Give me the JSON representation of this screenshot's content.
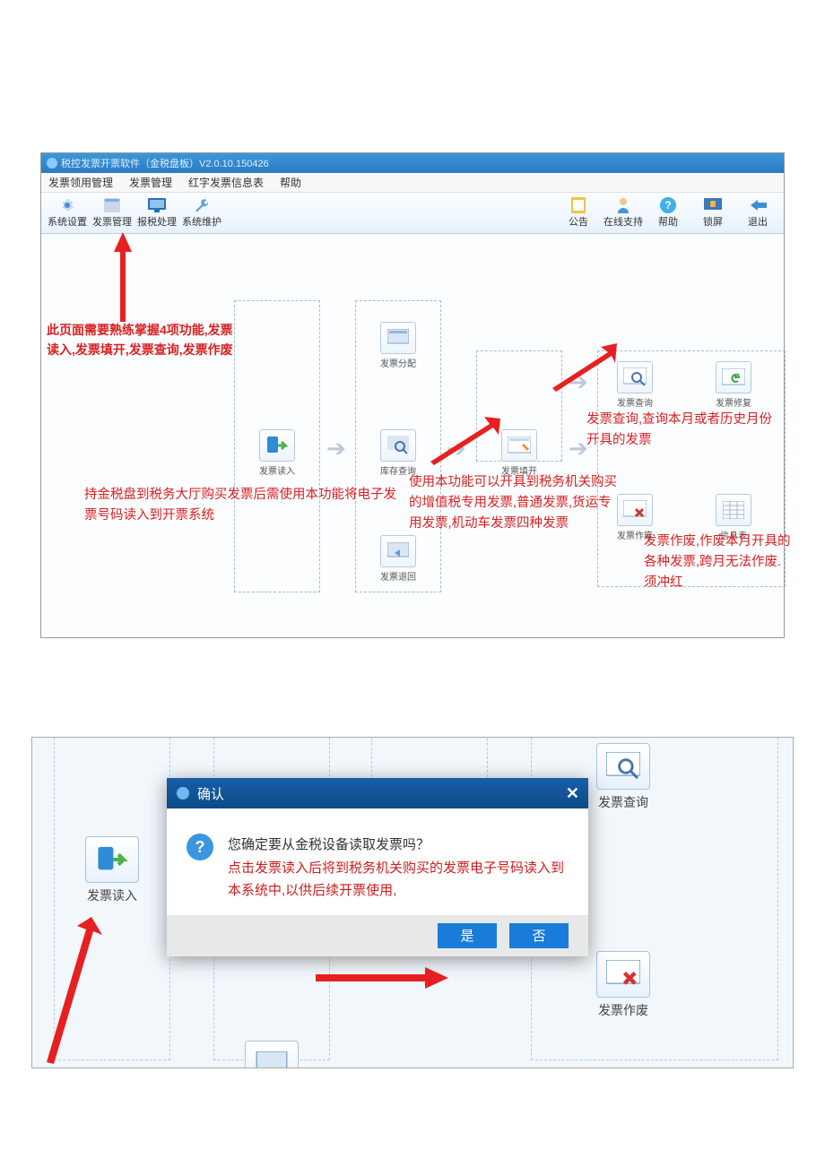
{
  "window_title": "税控发票开票软件（金税盘板）V2.0.10.150426",
  "menus": [
    "发票领用管理",
    "发票管理",
    "红字发票信息表",
    "帮助"
  ],
  "toolbar_left": [
    {
      "label": "系统设置",
      "icon": "gear-icon"
    },
    {
      "label": "发票管理",
      "icon": "grid-icon"
    },
    {
      "label": "报税处理",
      "icon": "monitor-icon"
    },
    {
      "label": "系统维护",
      "icon": "wrench-icon"
    }
  ],
  "toolbar_right": [
    {
      "label": "公告",
      "icon": "clipboard-icon"
    },
    {
      "label": "在线支持",
      "icon": "person-icon"
    },
    {
      "label": "帮助",
      "icon": "help-icon"
    },
    {
      "label": "锁屏",
      "icon": "lock-icon"
    },
    {
      "label": "退出",
      "icon": "back-icon"
    }
  ],
  "flow_icons": {
    "read_in": "发票读入",
    "dist": "发票分配",
    "stock": "库存查询",
    "return": "发票退回",
    "fill": "发票填开",
    "query": "发票查询",
    "repair": "发票修复",
    "void": "发票作废",
    "info": "信息表"
  },
  "annotations": {
    "top_left": "此页面需要熟练掌握4项功能,发票读入,发票填开,发票查询,发票作废",
    "read_in": "持金税盘到税务大厅购买发票后需使用本功能将电子发票号码读入到开票系统",
    "fill": "使用本功能可以开具到税务机关购买的增值税专用发票,普通发票,货运专用发票,机动车发票四种发票",
    "query": "发票查询,查询本月或者历史月份开具的发票",
    "void": "发票作废,作废本月开具的各种发票,跨月无法作废.须冲红"
  },
  "dialog": {
    "title": "确认",
    "line1": "您确定要从金税设备读取发票吗？",
    "line2": "点击发票读入后将到税务机关购买的发票电子号码读入到本系统中,以供后续开票使用,",
    "yes": "是",
    "no": "否"
  },
  "s2_icons": {
    "read_in": "发票读入",
    "query": "发票查询",
    "void": "发票作废"
  }
}
